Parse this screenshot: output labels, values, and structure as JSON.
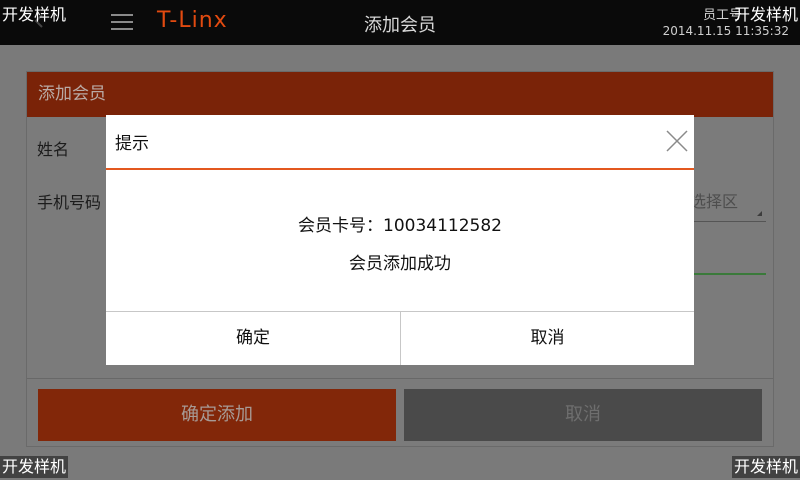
{
  "topbar": {
    "brand": "T-Linx",
    "title": "添加会员",
    "staff": "员工号",
    "datetime": "2014.11.15 11:35:32"
  },
  "watermark": "开发样机",
  "form": {
    "header": "添加会员",
    "name_label": "姓名",
    "phone_label": "手机号码",
    "select_placeholder": "选择区",
    "confirm_add_label": "确定添加",
    "cancel_label": "取消"
  },
  "dialog": {
    "title": "提示",
    "card_label": "会员卡号：",
    "card_number": "10034112582",
    "message": "会员添加成功",
    "ok_label": "确定",
    "cancel_label": "取消"
  },
  "colors": {
    "accent": "#e3581f",
    "brand": "#e24a10",
    "header_dim": "#7a2308"
  }
}
